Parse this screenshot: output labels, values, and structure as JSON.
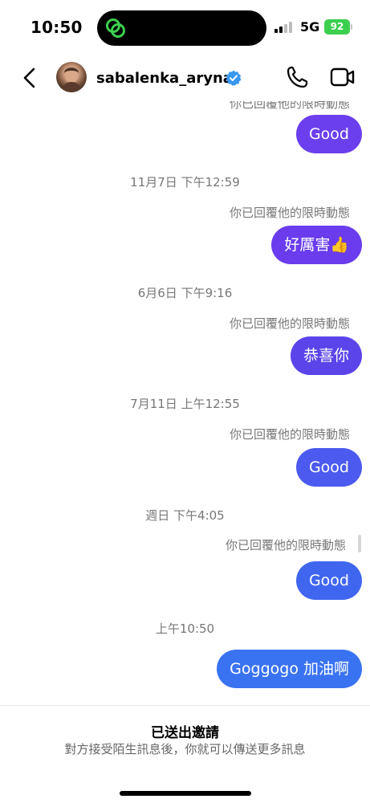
{
  "status_bar": {
    "time": "10:50",
    "network": "5G",
    "battery": "92",
    "battery_color": "#3ccf4e",
    "island_icon": "link-icon"
  },
  "header": {
    "username": "sabalenka_aryna",
    "verified": true,
    "back_icon": "chevron-left-icon",
    "call_icon": "phone-icon",
    "video_icon": "video-camera-icon"
  },
  "messages": [
    {
      "type": "label",
      "text": "你已回覆他的限時動態"
    },
    {
      "type": "bubble",
      "text": "Good",
      "color": "#6c3fee"
    },
    {
      "type": "timestamp",
      "text": "11月7日 下午12:59"
    },
    {
      "type": "label",
      "text": "你已回覆他的限時動態"
    },
    {
      "type": "bubble",
      "text": "好厲害👍",
      "color": "#6a3ced"
    },
    {
      "type": "timestamp",
      "text": "6月6日 下午9:16"
    },
    {
      "type": "label",
      "text": "你已回覆他的限時動態"
    },
    {
      "type": "bubble",
      "text": "恭喜你",
      "color": "#5b44ea"
    },
    {
      "type": "timestamp",
      "text": "7月11日 上午12:55"
    },
    {
      "type": "label",
      "text": "你已回覆他的限時動態"
    },
    {
      "type": "bubble",
      "text": "Good",
      "color": "#4c5af0"
    },
    {
      "type": "timestamp",
      "text": "週日 下午4:05"
    },
    {
      "type": "label",
      "text": "你已回覆他的限時動態"
    },
    {
      "type": "bubble",
      "text": "Good",
      "color": "#4066f0"
    },
    {
      "type": "timestamp",
      "text": "上午10:50"
    },
    {
      "type": "bubble",
      "text": "Goggogo 加油啊",
      "color": "#3a73f2"
    }
  ],
  "footer": {
    "title": "已送出邀請",
    "subtitle": "對方接受陌生訊息後，你就可以傳送更多訊息"
  }
}
